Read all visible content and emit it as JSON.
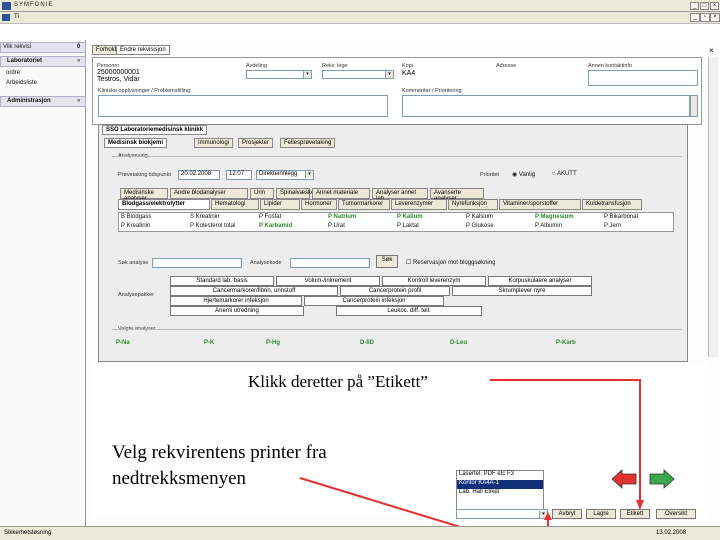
{
  "window": {
    "title": "SYMFONIE"
  },
  "menu": {
    "label": "Ti"
  },
  "sidebar": {
    "header": "Vilk rekvisi",
    "header_badge": "0",
    "sections": [
      {
        "label": "Laboratoriet",
        "badge": "»",
        "items": [
          "ordre",
          "Arbeidsliste"
        ]
      },
      {
        "label": "Administrasjon",
        "badge": "»",
        "items": []
      }
    ]
  },
  "tabs": [
    "Forhold",
    "Endre rekvisisjon"
  ],
  "patient": {
    "id_label": "Personnr",
    "id_value": "25000000001",
    "name": "Testros, Vidar",
    "field1_label": "Avdeling",
    "field2_label": "Rekv. lege",
    "field3_label": "Kopi",
    "field3_value": "KA4",
    "field4_label": "Adresse",
    "field5_label": "Annen kontaktinfo",
    "comment_label": "Kliniske opplysninger / Problemstilling:",
    "comment2_label": "Kommentar / Prioritering:"
  },
  "panel": {
    "title": "SSO Laboratoriemedisinsk klinikk",
    "tabs": [
      "Medisinsk biokjemi",
      "Immunologi",
      "Prosjekter",
      "Fellesprøvetaking"
    ],
    "section_label": "Analysevalg",
    "date_label": "Prøvetaking tidspunkt",
    "date_value": "20.02.2008",
    "time_value": "12:07",
    "mode_value": "Direkteinnlegg",
    "priority_label": "Prioritet",
    "priority_options": [
      "Vanlig",
      "AKUTT"
    ],
    "subtabs_row1": [
      "Medisinske analyser",
      "Andre blodanalyser",
      "Urin",
      "Spinalvæske",
      "Annet materiale",
      "Analyser annet lab",
      "Avanserte analyser"
    ],
    "subtabs_row2": [
      "Blodgass/elektrolytter",
      "Hematologi",
      "Lipider",
      "Hormoner",
      "Tumormarkorer",
      "Leverenzymer",
      "Nyrefunksjon",
      "Vitaminer/sporstoffer",
      "Kuldetransfusjon"
    ],
    "analyses_row1": [
      "B Blodgass",
      "S Kreatinin",
      "P Fosfat",
      "P Natrium",
      "P Kalium",
      "P Kalsium",
      "P Magnesium",
      "P Bikarbonat"
    ],
    "analyses_row2": [
      "P Kreatinin",
      "P Kolesterol total",
      "P Karbamid",
      "P Urat",
      "P Laktat",
      "P Glukose",
      "P Albumin",
      "P Jern"
    ],
    "search_label": "Søk analyse",
    "search_value": "",
    "search_button": "Søk",
    "reserve_label": "Reservasjon mot bloggsøkning",
    "groups_label": "Analysepakker",
    "groups": [
      "Standard lab. basis",
      "Volum-/inkrement",
      "Kontroll leverenzym",
      "Korpuskulaere analyser",
      "Cancermarkorer/fibrin, urinstoff",
      "Cancerprotein profil",
      "Skrumplever nyre",
      "Hjertemarkorer infeksjon",
      "Cancerprotein infeksjon",
      "Anemi utredning",
      "Leukoc. diff. tell."
    ],
    "selected_label": "Valgte analyser",
    "selected": [
      "P-Na",
      "P-K",
      "P-Hg",
      "D-IID",
      "D-Leu",
      "P-Karb"
    ]
  },
  "annotations": {
    "etikett": "Klikk deretter på ”Etikett”",
    "printer_line1": "Velg rekvirentens printer fra",
    "printer_line2": "nedtrekksmenyen"
  },
  "printer_menu": {
    "options": [
      "Lasertel. PDF etc F3",
      "Kontor KA4A-1",
      "Lab. Hall Etiket"
    ],
    "selected_index": 1
  },
  "buttons": {
    "avbryt": "Avbryt",
    "lagre": "Lagre",
    "etikett": "Etikett",
    "oversikt": "Oversikt"
  },
  "status": {
    "left": "Sikkerhetsløsning",
    "right": "13.02.2008"
  },
  "colors": {
    "arrow_red": "#e53030",
    "arrow_green": "#3aa84a",
    "accent_blue": "#12307a"
  }
}
